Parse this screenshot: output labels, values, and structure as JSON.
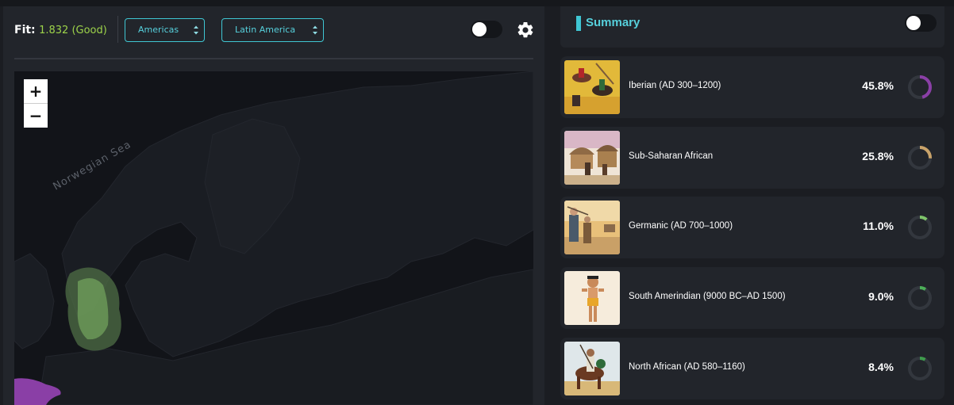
{
  "toolbar": {
    "fit_label": "Fit:",
    "fit_value": "1.832 (Good)",
    "region_select": "Americas",
    "subregion_select": "Latin America",
    "toggle_on": false,
    "settings_icon": "gear-icon"
  },
  "map": {
    "zoom_in_label": "+",
    "zoom_out_label": "−",
    "sea_label": "Norwegian Sea",
    "heat_colors": [
      "#6e9c5a",
      "#8a3fa6"
    ]
  },
  "summary": {
    "title": "Summary",
    "toggle_on": false,
    "accent_color": "#3fc6d3"
  },
  "populations": [
    {
      "name": "Iberian (AD 300–1200)",
      "percent_label": "45.8%",
      "percent": 45.8,
      "color": "#8a3fa6"
    },
    {
      "name": "Sub-Saharan African",
      "percent_label": "25.8%",
      "percent": 25.8,
      "color": "#c9a36a"
    },
    {
      "name": "Germanic (AD 700–1000)",
      "percent_label": "11.0%",
      "percent": 11.0,
      "color": "#7ec46a"
    },
    {
      "name": "South Amerindian (9000 BC–AD 1500)",
      "percent_label": "9.0%",
      "percent": 9.0,
      "color": "#4caf58"
    },
    {
      "name": "North African (AD 580–1160)",
      "percent_label": "8.4%",
      "percent": 8.4,
      "color": "#3e9b4c"
    }
  ]
}
